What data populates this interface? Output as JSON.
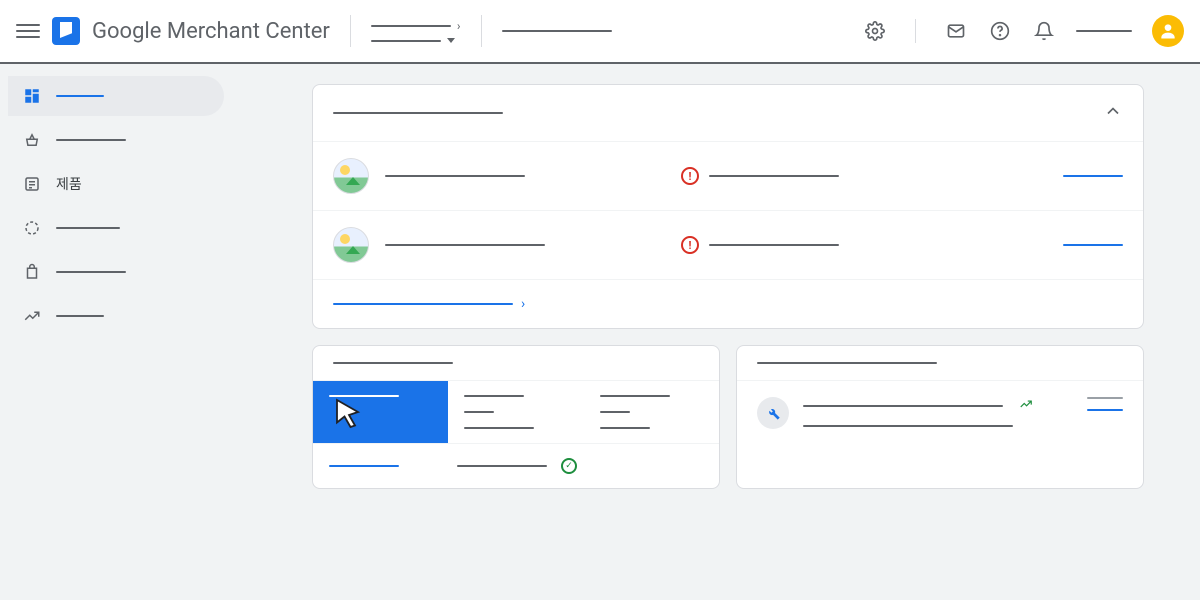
{
  "header": {
    "app_title": "Google Merchant Center",
    "account_selector": "",
    "breadcrumb_label": "",
    "search_label": ""
  },
  "sidebar": {
    "items": [
      {
        "icon": "dashboard",
        "label": "",
        "active": true
      },
      {
        "icon": "basket",
        "label": "",
        "active": false
      },
      {
        "icon": "list",
        "label": "제품",
        "active": false
      },
      {
        "icon": "circle-dashed",
        "label": "",
        "active": false
      },
      {
        "icon": "bag",
        "label": "",
        "active": false
      },
      {
        "icon": "trending",
        "label": "",
        "active": false
      }
    ]
  },
  "main": {
    "issues_card": {
      "title": "",
      "rows": [
        {
          "name": "",
          "status_text": "",
          "status": "error",
          "action": ""
        },
        {
          "name": "",
          "status_text": "",
          "status": "error",
          "action": ""
        }
      ],
      "footer_link": ""
    },
    "metrics_card": {
      "title": "",
      "columns": [
        {
          "title": "",
          "value": ""
        },
        {
          "title": "",
          "value": "",
          "subvalue": ""
        },
        {
          "title": "",
          "value": "",
          "subvalue": ""
        }
      ],
      "footer": {
        "link": "",
        "label": "",
        "status": "ok"
      }
    },
    "optimization_card": {
      "title": "",
      "item": {
        "line1": "",
        "line2": "",
        "trend": "up",
        "meta": "",
        "action": ""
      }
    }
  },
  "colors": {
    "accent": "#1a73e8",
    "error": "#d93025",
    "success": "#1e8e3e",
    "warning": "#fbbc04"
  }
}
